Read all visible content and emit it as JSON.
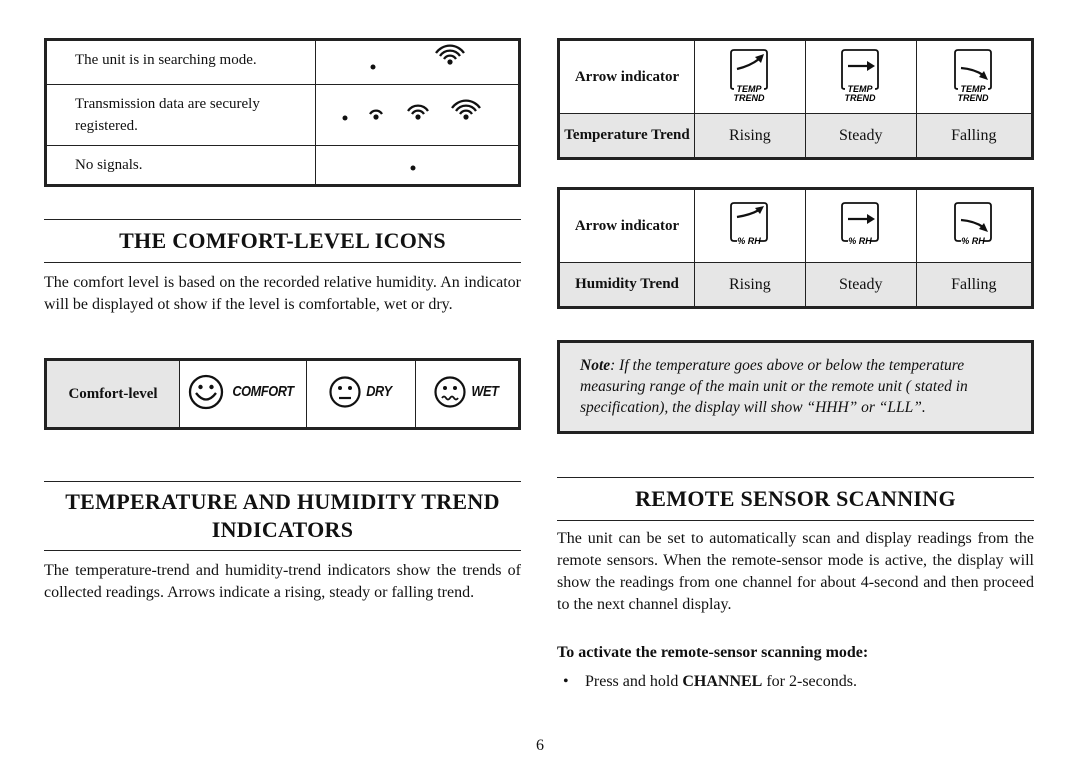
{
  "signal_table": {
    "rows": [
      {
        "text": "The unit is in searching mode.",
        "icon": "signal-searching-icon"
      },
      {
        "text": "Transmission data are securely registered.",
        "icon": "signal-registered-icon"
      },
      {
        "text": "No signals.",
        "icon": "signal-none-icon"
      }
    ]
  },
  "comfort_section": {
    "heading": "THE  COMFORT-LEVEL  ICONS",
    "paragraph": "The comfort level is based on the recorded relative humidity. An indicator will be displayed ot show if the level is comfortable, wet or dry.",
    "table": {
      "label": "Comfort-level",
      "items": [
        {
          "word": "COMFORT",
          "icon": "smiley-face-icon"
        },
        {
          "word": "DRY",
          "icon": "neutral-face-icon"
        },
        {
          "word": "WET",
          "icon": "wavy-mouth-face-icon"
        }
      ]
    }
  },
  "trend_section": {
    "heading_line1": "TEMPERATURE  AND  HUMIDITY  TREND",
    "heading_line2": "INDICATORS",
    "paragraph": "The temperature-trend and humidity-trend indicators show the trends of collected readings. Arrows indicate a rising, steady or falling trend."
  },
  "temp_trend_table": {
    "row1_label": "Arrow indicator",
    "row2_label": "Temperature Trend",
    "icon_caption_line1": "TEMP",
    "icon_caption_line2": "TREND",
    "values": [
      "Rising",
      "Steady",
      "Falling"
    ]
  },
  "humidity_trend_table": {
    "row1_label": "Arrow indicator",
    "row2_label": "Humidity Trend",
    "icon_caption": "% RH",
    "values": [
      "Rising",
      "Steady",
      "Falling"
    ]
  },
  "note": {
    "label": "Note",
    "text": ": If the temperature goes above or below the temperature measuring range of the main unit or the remote unit ( stated in specification), the display will show “HHH” or “LLL”."
  },
  "remote_section": {
    "heading": "REMOTE  SENSOR  SCANNING",
    "paragraph": "The unit can be set to automatically scan and display readings from the remote sensors. When the remote-sensor mode is active, the display will show the readings from one channel for about 4-second and then proceed to the next channel display.",
    "subheading": "To activate the remote-sensor scanning mode:",
    "bullet_prefix": "Press and hold ",
    "bullet_key": "CHANNEL",
    "bullet_suffix": " for 2-seconds."
  },
  "page_number": "6"
}
